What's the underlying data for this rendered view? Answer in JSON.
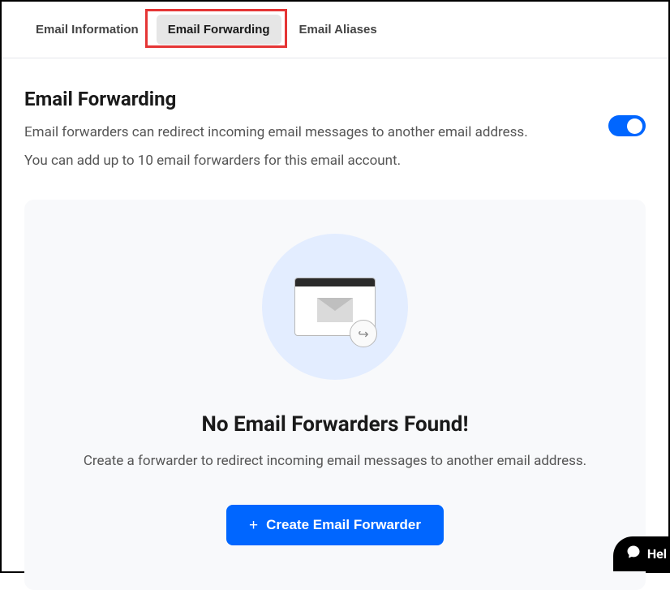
{
  "tabs": {
    "info": "Email Information",
    "forwarding": "Email Forwarding",
    "aliases": "Email Aliases"
  },
  "header": {
    "title": "Email Forwarding",
    "line1": "Email forwarders can redirect incoming email messages to another email address.",
    "line2": "You can add up to 10 email forwarders for this email account."
  },
  "emptyState": {
    "title": "No Email Forwarders Found!",
    "description": "Create a forwarder to redirect incoming email messages to another email address.",
    "buttonLabel": "Create Email Forwarder"
  },
  "help": {
    "label": "Hel"
  }
}
